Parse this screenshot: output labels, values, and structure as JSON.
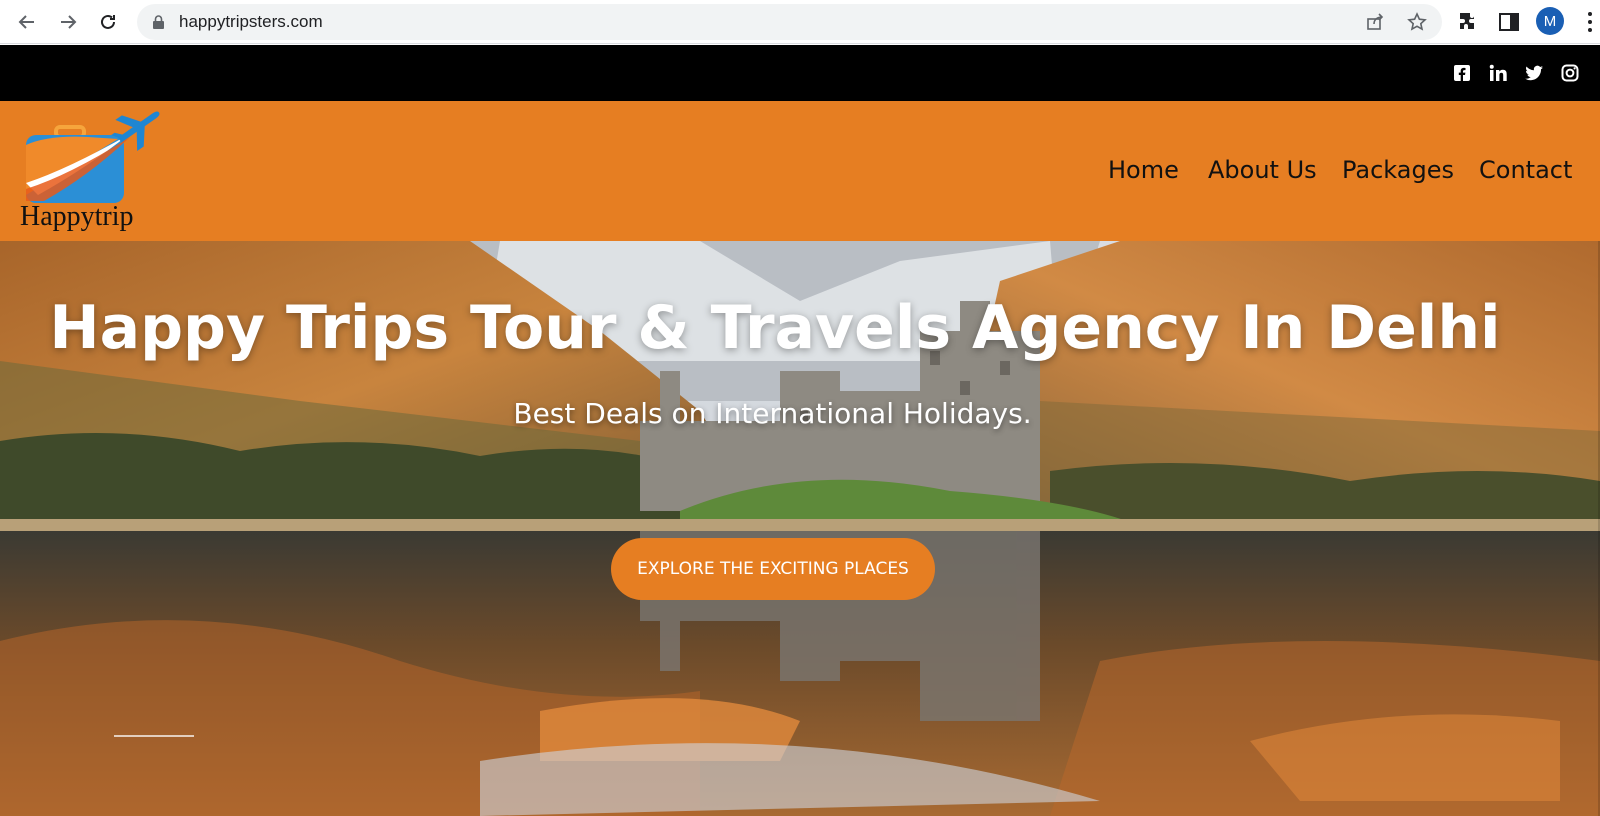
{
  "browser": {
    "url": "happytripsters.com",
    "avatar_letter": "M"
  },
  "social": {
    "icons": [
      "facebook-icon",
      "linkedin-icon",
      "twitter-icon",
      "instagram-icon"
    ]
  },
  "header": {
    "logo_text": "Happytrip",
    "nav": [
      "Home",
      "About Us",
      "Packages",
      "Contact"
    ]
  },
  "hero": {
    "title": "Happy Trips Tour & Travels Agency In Delhi",
    "subtitle": "Best Deals on International Holidays.",
    "cta_label": "EXPLORE THE EXCITING PLACES"
  },
  "colors": {
    "accent": "#e67e22",
    "topbar": "#000000",
    "text_light": "#ffffff"
  }
}
